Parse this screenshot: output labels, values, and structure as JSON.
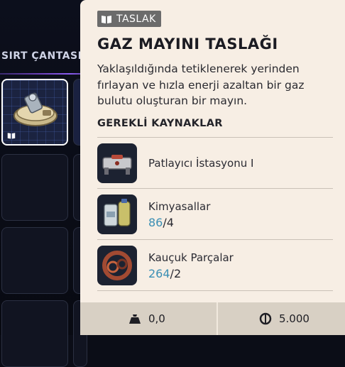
{
  "inventory": {
    "title": "SIRT ÇANTASI"
  },
  "card": {
    "tag_label": "TASLAK",
    "title": "GAZ MAYINI TASLAĞI",
    "description": "Yaklaşıldığında tetiklenerek yerinden fırlayan ve hızla enerji azaltan bir gaz bulutu oluşturan bir mayın.",
    "section_title": "GEREKLİ KAYNAKLAR",
    "resources": [
      {
        "name": "Patlayıcı İstasyonu I",
        "have": "",
        "sep": "",
        "need": "",
        "icon": "explosives-station-icon"
      },
      {
        "name": "Kimyasallar",
        "have": "86",
        "sep": "/",
        "need": "4",
        "icon": "chemicals-icon"
      },
      {
        "name": "Kauçuk Parçalar",
        "have": "264",
        "sep": "/",
        "need": "2",
        "icon": "rubber-parts-icon"
      }
    ]
  },
  "footer": {
    "weight": "0,0",
    "price": "5.000"
  },
  "colors": {
    "card_bg": "#f7eee4",
    "have_text": "#3b8fb4",
    "tag_bg": "#6b6b6b",
    "active_slot_border": "#ffffff"
  }
}
